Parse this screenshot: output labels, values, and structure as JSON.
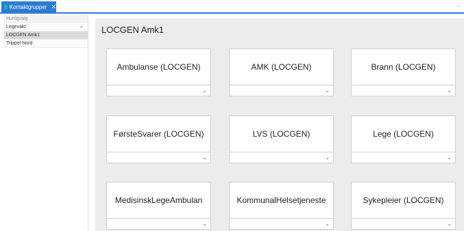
{
  "tab": {
    "label": "Kontaktgrupper",
    "close": "✕"
  },
  "tab_overflow": "⌄",
  "sidebar": {
    "header": "Hurtigvalg",
    "collapse": "^",
    "items": [
      {
        "label": "Legevakt"
      },
      {
        "label": "LOCGEN Amk1"
      },
      {
        "label": "Trippel Nord"
      }
    ]
  },
  "main": {
    "title": "LOCGEN Amk1",
    "cards": [
      {
        "label": "Ambulanse (LOCGEN)"
      },
      {
        "label": "AMK (LOCGEN)"
      },
      {
        "label": "Brann (LOCGEN)"
      },
      {
        "label": "FørsteSvarer (LOCGEN)"
      },
      {
        "label": "LVS (LOCGEN)"
      },
      {
        "label": "Lege (LOCGEN)"
      },
      {
        "label": "MedisinskLegeAmbulan"
      },
      {
        "label": "KommunalHelsetjeneste"
      },
      {
        "label": "Sykepleier (LOCGEN)"
      }
    ],
    "dropdown_icon": "⌄"
  }
}
